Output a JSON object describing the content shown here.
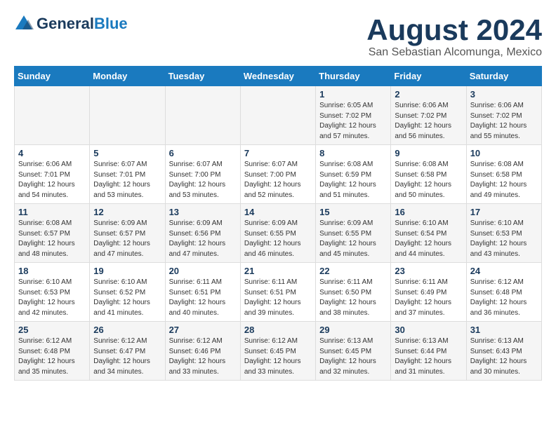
{
  "header": {
    "logo_line1": "General",
    "logo_line2": "Blue",
    "month": "August 2024",
    "location": "San Sebastian Alcomunga, Mexico"
  },
  "weekdays": [
    "Sunday",
    "Monday",
    "Tuesday",
    "Wednesday",
    "Thursday",
    "Friday",
    "Saturday"
  ],
  "weeks": [
    [
      {
        "day": "",
        "info": ""
      },
      {
        "day": "",
        "info": ""
      },
      {
        "day": "",
        "info": ""
      },
      {
        "day": "",
        "info": ""
      },
      {
        "day": "1",
        "info": "Sunrise: 6:05 AM\nSunset: 7:02 PM\nDaylight: 12 hours\nand 57 minutes."
      },
      {
        "day": "2",
        "info": "Sunrise: 6:06 AM\nSunset: 7:02 PM\nDaylight: 12 hours\nand 56 minutes."
      },
      {
        "day": "3",
        "info": "Sunrise: 6:06 AM\nSunset: 7:02 PM\nDaylight: 12 hours\nand 55 minutes."
      }
    ],
    [
      {
        "day": "4",
        "info": "Sunrise: 6:06 AM\nSunset: 7:01 PM\nDaylight: 12 hours\nand 54 minutes."
      },
      {
        "day": "5",
        "info": "Sunrise: 6:07 AM\nSunset: 7:01 PM\nDaylight: 12 hours\nand 53 minutes."
      },
      {
        "day": "6",
        "info": "Sunrise: 6:07 AM\nSunset: 7:00 PM\nDaylight: 12 hours\nand 53 minutes."
      },
      {
        "day": "7",
        "info": "Sunrise: 6:07 AM\nSunset: 7:00 PM\nDaylight: 12 hours\nand 52 minutes."
      },
      {
        "day": "8",
        "info": "Sunrise: 6:08 AM\nSunset: 6:59 PM\nDaylight: 12 hours\nand 51 minutes."
      },
      {
        "day": "9",
        "info": "Sunrise: 6:08 AM\nSunset: 6:58 PM\nDaylight: 12 hours\nand 50 minutes."
      },
      {
        "day": "10",
        "info": "Sunrise: 6:08 AM\nSunset: 6:58 PM\nDaylight: 12 hours\nand 49 minutes."
      }
    ],
    [
      {
        "day": "11",
        "info": "Sunrise: 6:08 AM\nSunset: 6:57 PM\nDaylight: 12 hours\nand 48 minutes."
      },
      {
        "day": "12",
        "info": "Sunrise: 6:09 AM\nSunset: 6:57 PM\nDaylight: 12 hours\nand 47 minutes."
      },
      {
        "day": "13",
        "info": "Sunrise: 6:09 AM\nSunset: 6:56 PM\nDaylight: 12 hours\nand 47 minutes."
      },
      {
        "day": "14",
        "info": "Sunrise: 6:09 AM\nSunset: 6:55 PM\nDaylight: 12 hours\nand 46 minutes."
      },
      {
        "day": "15",
        "info": "Sunrise: 6:09 AM\nSunset: 6:55 PM\nDaylight: 12 hours\nand 45 minutes."
      },
      {
        "day": "16",
        "info": "Sunrise: 6:10 AM\nSunset: 6:54 PM\nDaylight: 12 hours\nand 44 minutes."
      },
      {
        "day": "17",
        "info": "Sunrise: 6:10 AM\nSunset: 6:53 PM\nDaylight: 12 hours\nand 43 minutes."
      }
    ],
    [
      {
        "day": "18",
        "info": "Sunrise: 6:10 AM\nSunset: 6:53 PM\nDaylight: 12 hours\nand 42 minutes."
      },
      {
        "day": "19",
        "info": "Sunrise: 6:10 AM\nSunset: 6:52 PM\nDaylight: 12 hours\nand 41 minutes."
      },
      {
        "day": "20",
        "info": "Sunrise: 6:11 AM\nSunset: 6:51 PM\nDaylight: 12 hours\nand 40 minutes."
      },
      {
        "day": "21",
        "info": "Sunrise: 6:11 AM\nSunset: 6:51 PM\nDaylight: 12 hours\nand 39 minutes."
      },
      {
        "day": "22",
        "info": "Sunrise: 6:11 AM\nSunset: 6:50 PM\nDaylight: 12 hours\nand 38 minutes."
      },
      {
        "day": "23",
        "info": "Sunrise: 6:11 AM\nSunset: 6:49 PM\nDaylight: 12 hours\nand 37 minutes."
      },
      {
        "day": "24",
        "info": "Sunrise: 6:12 AM\nSunset: 6:48 PM\nDaylight: 12 hours\nand 36 minutes."
      }
    ],
    [
      {
        "day": "25",
        "info": "Sunrise: 6:12 AM\nSunset: 6:48 PM\nDaylight: 12 hours\nand 35 minutes."
      },
      {
        "day": "26",
        "info": "Sunrise: 6:12 AM\nSunset: 6:47 PM\nDaylight: 12 hours\nand 34 minutes."
      },
      {
        "day": "27",
        "info": "Sunrise: 6:12 AM\nSunset: 6:46 PM\nDaylight: 12 hours\nand 33 minutes."
      },
      {
        "day": "28",
        "info": "Sunrise: 6:12 AM\nSunset: 6:45 PM\nDaylight: 12 hours\nand 33 minutes."
      },
      {
        "day": "29",
        "info": "Sunrise: 6:13 AM\nSunset: 6:45 PM\nDaylight: 12 hours\nand 32 minutes."
      },
      {
        "day": "30",
        "info": "Sunrise: 6:13 AM\nSunset: 6:44 PM\nDaylight: 12 hours\nand 31 minutes."
      },
      {
        "day": "31",
        "info": "Sunrise: 6:13 AM\nSunset: 6:43 PM\nDaylight: 12 hours\nand 30 minutes."
      }
    ]
  ]
}
